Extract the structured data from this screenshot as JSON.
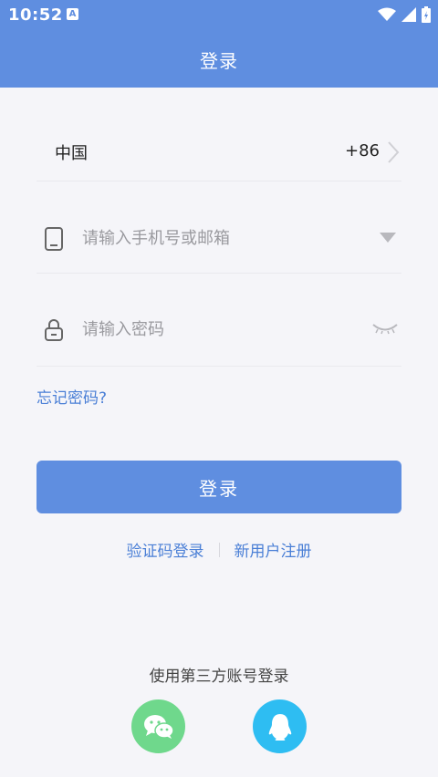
{
  "status_bar": {
    "time": "10:52",
    "notification_badge": "A",
    "icons": [
      "wifi-icon",
      "signal-icon",
      "battery-icon"
    ]
  },
  "header": {
    "title": "登录"
  },
  "form": {
    "country_name": "中国",
    "country_code": "+86",
    "phone_placeholder": "请输入手机号或邮箱",
    "password_placeholder": "请输入密码",
    "forgot_label": "忘记密码?",
    "login_label": "登录"
  },
  "links": {
    "code_login": "验证码登录",
    "register": "新用户注册"
  },
  "third_party": {
    "title": "使用第三方账号登录",
    "providers": [
      "wechat-icon",
      "qq-icon"
    ]
  },
  "colors": {
    "primary": "#5f8ee0",
    "link": "#4a7fd6",
    "background": "#f5f5f9",
    "wechat": "#6fd88c",
    "qq": "#2ebdf2"
  }
}
